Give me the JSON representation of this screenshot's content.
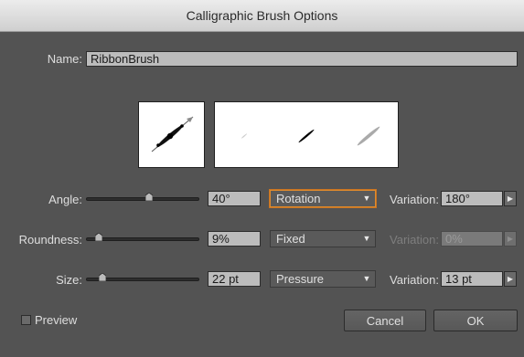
{
  "window": {
    "title": "Calligraphic Brush Options"
  },
  "name_field": {
    "label": "Name:",
    "value": "RibbonBrush"
  },
  "angle": {
    "label": "Angle:",
    "value": "40°",
    "slider_position": 0.56,
    "mode": "Rotation",
    "variation_label": "Variation:",
    "variation_value": "180°"
  },
  "roundness": {
    "label": "Roundness:",
    "value": "9%",
    "slider_position": 0.09,
    "mode": "Fixed",
    "variation_label": "Variation:",
    "variation_value": "0%"
  },
  "size": {
    "label": "Size:",
    "value": "22 pt",
    "slider_position": 0.12,
    "mode": "Pressure",
    "variation_label": "Variation:",
    "variation_value": "13 pt"
  },
  "preview": {
    "label": "Preview"
  },
  "buttons": {
    "cancel": "Cancel",
    "ok": "OK"
  },
  "icons": {
    "dropdown": "triangle-down-icon",
    "stepper": "triangle-right-icon"
  },
  "colors": {
    "background": "#535353",
    "focus": "#e08a2c",
    "field": "#bcbcbc"
  }
}
